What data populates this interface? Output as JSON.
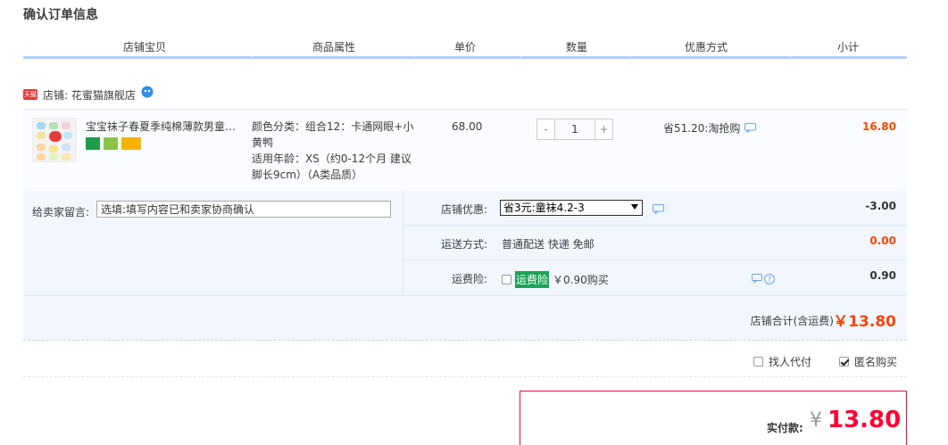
{
  "page": {
    "title": "确认订单信息"
  },
  "columns": [
    "店铺宝贝",
    "商品属性",
    "单价",
    "数量",
    "优惠方式",
    "小计"
  ],
  "shop": {
    "badge": "天猫",
    "label": "店铺: 花蜜猫旗舰店"
  },
  "item": {
    "title": "宝宝袜子春夏季纯棉薄款男童女...",
    "attr_color": "颜色分类：组合12：卡通网眼+小黄鸭",
    "attr_age": "适用年龄：XS（约0-12个月 建议脚长9cm）（A类品质）",
    "price": "68.00",
    "qty_minus": "-",
    "qty_value": "1",
    "qty_plus": "+",
    "promo": "省51.20:淘抢购",
    "subtotal": "16.80"
  },
  "message": {
    "label": "给卖家留言:",
    "placeholder": "选填:填写内容已和卖家协商确认"
  },
  "store_discount": {
    "label": "店铺优惠:",
    "selected": "省3元:童袜4.2-3",
    "value": "-3.00"
  },
  "shipping": {
    "label": "运送方式:",
    "method": "普通配送 快递 免邮",
    "value": "0.00"
  },
  "insurance": {
    "label": "运费险:",
    "tag": "运费险",
    "price": "￥0.90购买",
    "value": "0.90"
  },
  "shop_total": {
    "label": "店铺合计(含运费)",
    "amount": "￥13.80"
  },
  "options": {
    "proxy_label": "找人代付",
    "anonymous_label": "匿名购买"
  },
  "payment": {
    "label": "实付款:",
    "currency": "¥",
    "amount": "13.80"
  },
  "colors": {
    "accent": "#f40",
    "pay_red": "#ff0036",
    "header_border": "#b2d1ff",
    "panel_bg": "#f2f7ff"
  }
}
